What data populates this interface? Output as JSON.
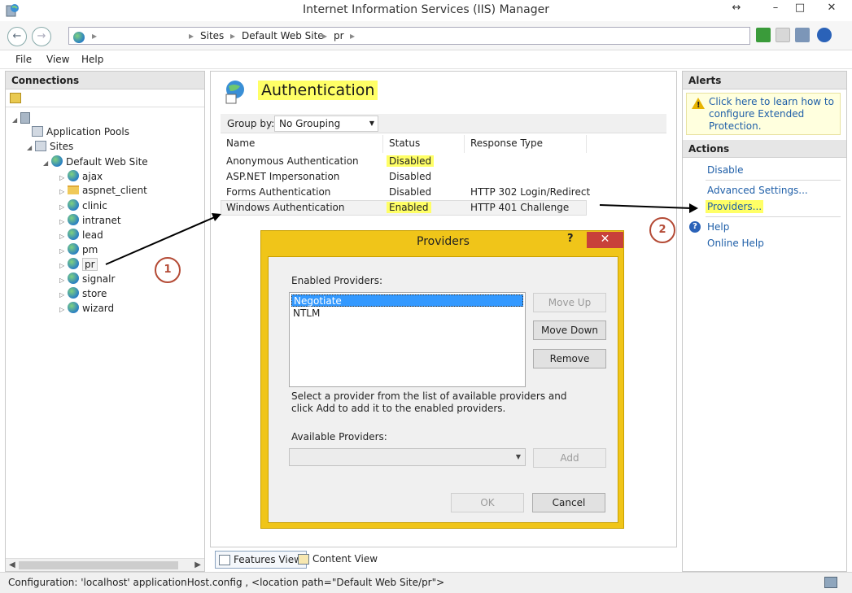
{
  "window": {
    "title": "Internet Information Services (IIS) Manager",
    "resize_glyph": "↔",
    "minimize": "–",
    "maximize": "□",
    "close": "✕"
  },
  "address": {
    "back": "←",
    "forward": "→",
    "separator": "▸",
    "crumbs": [
      "Sites",
      "Default Web Site",
      "pr"
    ]
  },
  "menu": [
    "File",
    "View",
    "Help"
  ],
  "connections": {
    "header": "Connections",
    "tree": {
      "app_pools": "Application Pools",
      "sites": "Sites",
      "default_site": "Default Web Site",
      "children": [
        "ajax",
        "aspnet_client",
        "clinic",
        "intranet",
        "lead",
        "pm",
        "pr",
        "signalr",
        "store",
        "wizard"
      ]
    }
  },
  "feature": {
    "title": "Authentication",
    "group_by_label": "Group by:",
    "group_by_value": "No Grouping",
    "columns": [
      "Name",
      "Status",
      "Response Type"
    ],
    "rows": [
      {
        "name": "Anonymous Authentication",
        "status": "Disabled",
        "response": ""
      },
      {
        "name": "ASP.NET Impersonation",
        "status": "Disabled",
        "response": ""
      },
      {
        "name": "Forms Authentication",
        "status": "Disabled",
        "response": "HTTP 302 Login/Redirect"
      },
      {
        "name": "Windows Authentication",
        "status": "Enabled",
        "response": "HTTP 401 Challenge"
      }
    ]
  },
  "view_tabs": {
    "features": "Features View",
    "content": "Content View"
  },
  "alerts": {
    "header": "Alerts",
    "message": "Click here to learn how to configure Extended Protection."
  },
  "actions": {
    "header": "Actions",
    "disable": "Disable",
    "advanced": "Advanced Settings...",
    "providers": "Providers...",
    "help": "Help",
    "online_help": "Online Help"
  },
  "dialog": {
    "title": "Providers",
    "help_glyph": "?",
    "close_glyph": "✕",
    "enabled_label": "Enabled Providers:",
    "enabled_providers": [
      "Negotiate",
      "NTLM"
    ],
    "move_up": "Move Up",
    "move_down": "Move Down",
    "remove": "Remove",
    "hint": "Select a provider from the list of available providers and click Add to add it to the enabled providers.",
    "available_label": "Available Providers:",
    "available_value": "",
    "add": "Add",
    "ok": "OK",
    "cancel": "Cancel"
  },
  "annotations": {
    "step1": "1",
    "step2": "2",
    "highlight_color": "#ffff66",
    "circle_color": "#b44a35"
  },
  "status_bar": "Configuration: 'localhost' applicationHost.config , <location path=\"Default Web Site/pr\">"
}
